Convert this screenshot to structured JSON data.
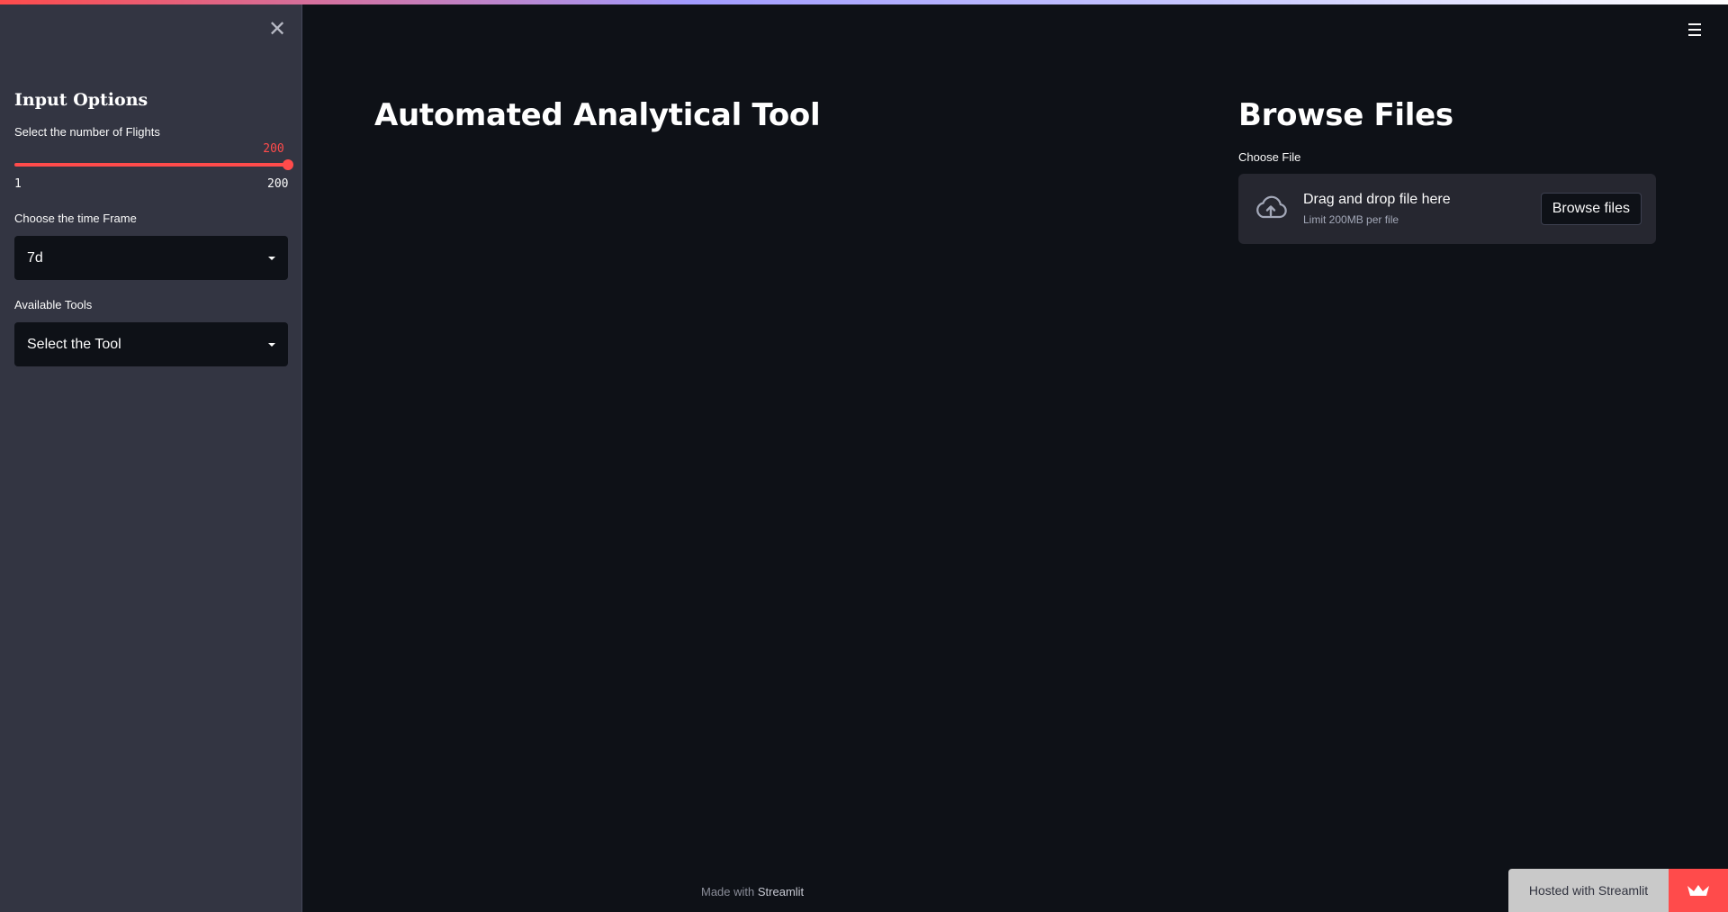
{
  "sidebar": {
    "close_icon": "close-icon",
    "title": "Input Options",
    "flights_slider": {
      "label": "Select the number of Flights",
      "value": "200",
      "min": "1",
      "max": "200",
      "accent_color": "#ff4b4b"
    },
    "timeframe_select": {
      "label": "Choose the time Frame",
      "value": "7d"
    },
    "tools_select": {
      "label": "Available Tools",
      "value": "Select the Tool"
    }
  },
  "main": {
    "title": "Automated Analytical Tool",
    "browse": {
      "title": "Browse Files",
      "uploader_label": "Choose File",
      "drop_text": "Drag and drop file here",
      "limit_text": "Limit 200MB per file",
      "button_label": "Browse files",
      "icon": "cloud-upload-icon"
    }
  },
  "menu_icon": "hamburger-menu-icon",
  "footer": {
    "prefix": "Made with",
    "link": "Streamlit"
  },
  "hosted_badge": {
    "text": "Hosted with Streamlit",
    "icon": "streamlit-crown-icon",
    "color": "#ff4b4b"
  },
  "colors": {
    "background": "#0e1117",
    "sidebar_background": "#333542",
    "accent": "#ff4b4b"
  }
}
